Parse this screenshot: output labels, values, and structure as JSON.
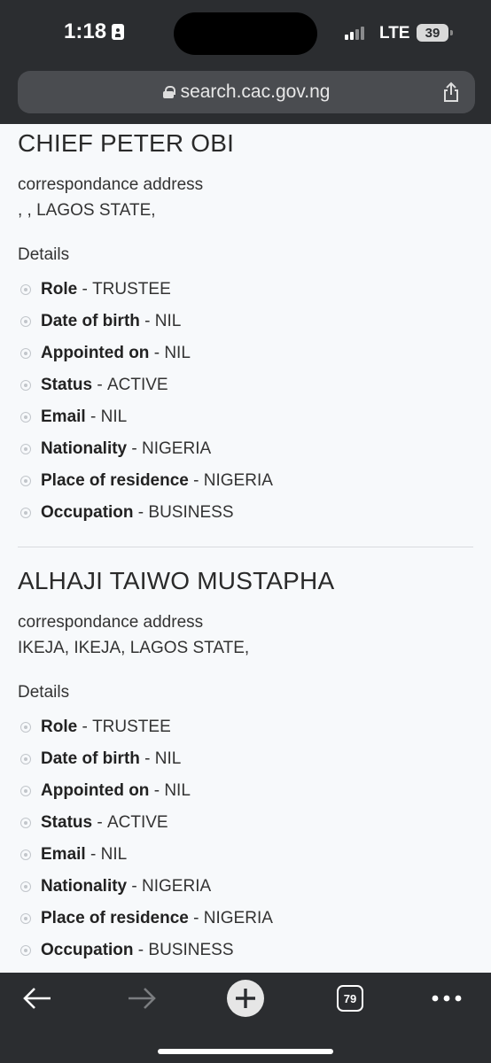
{
  "status": {
    "time": "1:18",
    "network": "LTE",
    "battery": "39"
  },
  "browser": {
    "url": "search.cac.gov.ng",
    "tab_count": "79"
  },
  "persons": [
    {
      "name": "CHIEF PETER OBI",
      "address_label": "correspondance address",
      "address": ", , LAGOS STATE,",
      "details_label": "Details",
      "details": [
        {
          "key": "Role",
          "value": "TRUSTEE"
        },
        {
          "key": "Date of birth",
          "value": "NIL"
        },
        {
          "key": "Appointed on",
          "value": "NIL"
        },
        {
          "key": "Status",
          "value": "ACTIVE"
        },
        {
          "key": "Email",
          "value": "NIL"
        },
        {
          "key": "Nationality",
          "value": "NIGERIA"
        },
        {
          "key": "Place of residence",
          "value": "NIGERIA"
        },
        {
          "key": "Occupation",
          "value": "BUSINESS"
        }
      ]
    },
    {
      "name": "ALHAJI TAIWO MUSTAPHA",
      "address_label": "correspondance address",
      "address": "IKEJA, IKEJA, LAGOS STATE,",
      "details_label": "Details",
      "details": [
        {
          "key": "Role",
          "value": "TRUSTEE"
        },
        {
          "key": "Date of birth",
          "value": "NIL"
        },
        {
          "key": "Appointed on",
          "value": "NIL"
        },
        {
          "key": "Status",
          "value": "ACTIVE"
        },
        {
          "key": "Email",
          "value": "NIL"
        },
        {
          "key": "Nationality",
          "value": "NIGERIA"
        },
        {
          "key": "Place of residence",
          "value": "NIGERIA"
        },
        {
          "key": "Occupation",
          "value": "BUSINESS"
        }
      ]
    }
  ],
  "details_separator": " - ",
  "colors": {
    "chrome": "#2b2d30",
    "url_bar": "#4a4c50",
    "page_bg": "#f7f9fb"
  }
}
